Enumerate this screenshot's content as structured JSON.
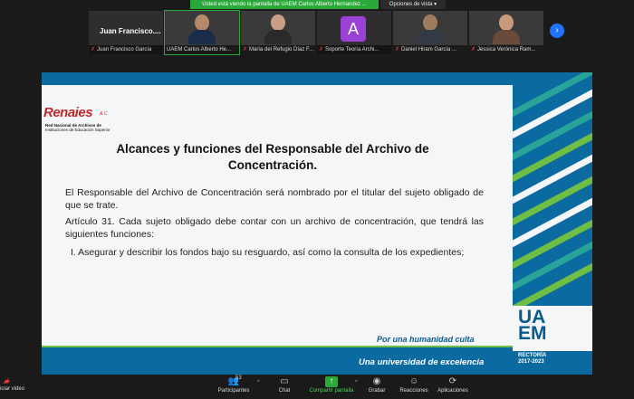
{
  "banner": {
    "text": "Usted está viendo la pantalla de UAEM  Carlos Alberto Hernandez ..."
  },
  "view_options": {
    "label": "Opciones de vista"
  },
  "participants": [
    {
      "name": "Juan Francisco García",
      "display": "Juan  Francisco....",
      "muted": true,
      "type": "name-only"
    },
    {
      "name": "UAEM Carlos Alberto He...",
      "muted": false,
      "type": "video",
      "active": true,
      "head_color": "#b48a6a",
      "body_color": "#1b2b4a"
    },
    {
      "name": "María del Refugio Díaz F...",
      "muted": true,
      "type": "video",
      "head_color": "#c9a085",
      "body_color": "#2a2a2a"
    },
    {
      "name": "Soporte Teoría Archi...",
      "muted": true,
      "type": "avatar",
      "avatar_letter": "A"
    },
    {
      "name": "Daniel Hiram García ...",
      "muted": true,
      "type": "video",
      "head_color": "#a07c5e",
      "body_color": "#333a45"
    },
    {
      "name": "Jessica Verónica Ram...",
      "muted": true,
      "type": "video",
      "head_color": "#c79a7c",
      "body_color": "#6a4a3a"
    }
  ],
  "slide": {
    "logo": {
      "name": "Renaies",
      "suffix": "A.C.",
      "line1": "Red Nacional de Archivos de",
      "line2": "Instituciones de Educación Superior"
    },
    "title": "Alcances y funciones del Responsable del Archivo  de Concentración.",
    "paragraphs": [
      "El Responsable del Archivo de Concentración será nombrado por el titular del sujeto obligado de que se trate.",
      "Artículo 31. Cada sujeto obligado debe contar con un archivo de concentración, que tendrá las siguientes funciones:",
      "  I. Asegurar y describir los fondos bajo su resguardo, así como la consulta de los expedientes;"
    ],
    "motto": "Por una humanidad culta",
    "footer_text": "Una universidad de excelencia",
    "brand": {
      "line1": "UA",
      "line2": "EM"
    },
    "rectoria": {
      "line1": "RECTORÍA",
      "line2": "2017-2023"
    },
    "colors": {
      "blue": "#0b6aa0",
      "green": "#6fbf44",
      "teal": "#2aa49b"
    }
  },
  "toolbar": {
    "start_video": "iciar video",
    "participants_label": "Participantes",
    "participants_count": "53",
    "chat": "Chat",
    "share": "Compartir pantalla",
    "record": "Grabar",
    "reactions": "Reacciones",
    "apps": "Aplicaciones"
  }
}
